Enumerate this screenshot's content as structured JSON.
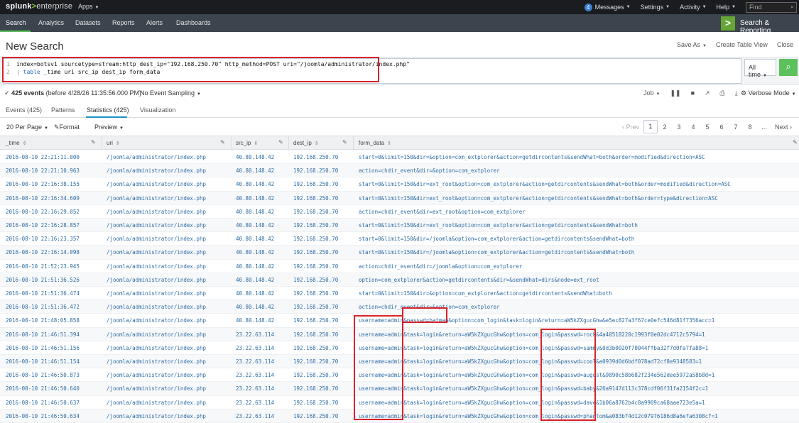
{
  "topbar": {
    "logo_main": "splunk",
    "logo_gt": ">",
    "logo_suffix": "enterprise",
    "apps": "Apps",
    "messages_count": "4",
    "messages": "Messages",
    "settings": "Settings",
    "activity": "Activity",
    "help": "Help",
    "find_placeholder": "Find"
  },
  "appbar": {
    "items": [
      "Search",
      "Analytics",
      "Datasets",
      "Reports",
      "Alerts",
      "Dashboards"
    ],
    "app_name": "Search & Reporting"
  },
  "title": {
    "text": "New Search",
    "save_as": "Save As",
    "create_table_view": "Create Table View",
    "close": "Close"
  },
  "search": {
    "line1": "index=botsv1 sourcetype=stream:http dest_ip=\"192.168.250.70\" http_method=POST uri=\"/joomla/administrator/index.php\"",
    "line2_pipe": "| ",
    "line2_cmd": "table",
    "line2_rest": " _time uri src_ip dest_ip form_data",
    "line_numbers": [
      "1",
      "2"
    ],
    "time_range": "All time",
    "icons": {
      "run": "search-icon"
    }
  },
  "status": {
    "check": "✓",
    "events_count": "425 events",
    "events_detail": "(before 4/28/26 11:35:56.000 PM)",
    "sampling": "No Event Sampling",
    "job": "Job",
    "mode": "Verbose Mode"
  },
  "tabs": [
    "Events (425)",
    "Patterns",
    "Statistics (425)",
    "Visualization"
  ],
  "toolbar": {
    "per_page": "20 Per Page",
    "format": "Format",
    "preview": "Preview"
  },
  "pager": {
    "prev": "‹ Prev",
    "pages": [
      "1",
      "2",
      "3",
      "4",
      "5",
      "6",
      "7",
      "8"
    ],
    "ellipsis": "...",
    "next": "Next ›"
  },
  "table": {
    "columns": [
      "_time",
      "uri",
      "src_ip",
      "dest_ip",
      "form_data"
    ],
    "rows": [
      [
        "2016-08-10 22:21:11.000",
        "/joomla/administrator/index.php",
        "40.80.148.42",
        "192.168.250.70",
        "start=0&limit=150&dir=&option=com_extplorer&action=getdircontents&sendWhat=both&order=modified&direction=ASC"
      ],
      [
        "2016-08-10 22:21:10.963",
        "/joomla/administrator/index.php",
        "40.80.148.42",
        "192.168.250.70",
        "action=chdir_event&dir=&option=com_extplorer"
      ],
      [
        "2016-08-10 22:16:38.155",
        "/joomla/administrator/index.php",
        "40.80.148.42",
        "192.168.250.70",
        "start=0&limit=150&dir=ext_root&option=com_extplorer&action=getdircontents&sendWhat=both&order=modified&direction=ASC"
      ],
      [
        "2016-08-10 22:16:34.609",
        "/joomla/administrator/index.php",
        "40.80.148.42",
        "192.168.250.70",
        "start=0&limit=150&dir=ext_root&option=com_extplorer&action=getdircontents&sendWhat=both&order=type&direction=ASC"
      ],
      [
        "2016-08-10 22:16:29.052",
        "/joomla/administrator/index.php",
        "40.80.148.42",
        "192.168.250.70",
        "action=chdir_event&dir=ext_root&option=com_extplorer"
      ],
      [
        "2016-08-10 22:16:28.857",
        "/joomla/administrator/index.php",
        "40.80.148.42",
        "192.168.250.70",
        "start=0&limit=150&dir=ext_root&option=com_extplorer&action=getdircontents&sendWhat=both"
      ],
      [
        "2016-08-10 22:16:23.357",
        "/joomla/administrator/index.php",
        "40.80.148.42",
        "192.168.250.70",
        "start=0&limit=150&dir=/joomla&option=com_extplorer&action=getdircontents&sendWhat=both"
      ],
      [
        "2016-08-10 22:16:14.098",
        "/joomla/administrator/index.php",
        "40.80.148.42",
        "192.168.250.70",
        "start=0&limit=150&dir=/joomla&option=com_extplorer&action=getdircontents&sendWhat=both"
      ],
      [
        "2016-08-10 21:52:23.945",
        "/joomla/administrator/index.php",
        "40.80.148.42",
        "192.168.250.70",
        "action=chdir_event&dir=/joomla&option=com_extplorer"
      ],
      [
        "2016-08-10 21:51:36.526",
        "/joomla/administrator/index.php",
        "40.80.148.42",
        "192.168.250.70",
        "option=com_extplorer&action=getdircontents&dir=&sendWhat=dirs&node=ext_root"
      ],
      [
        "2016-08-10 21:51:36.474",
        "/joomla/administrator/index.php",
        "40.80.148.42",
        "192.168.250.70",
        "start=0&limit=150&dir=&option=com_extplorer&action=getdircontents&sendWhat=both"
      ],
      [
        "2016-08-10 21:51:36.472",
        "/joomla/administrator/index.php",
        "40.80.148.42",
        "192.168.250.70",
        "action=chdir_event&dir=&option=com_extplorer"
      ],
      [
        "2016-08-10 21:48:05.858",
        "/joomla/administrator/index.php",
        "40.80.148.42",
        "192.168.250.70",
        "username=admin&passwd=batman&option=com_login&task=login&return=aW5kZXgucGhw&e5ec827a3f67ce0efc546d81f7356acc=1"
      ],
      [
        "2016-08-10 21:46:51.394",
        "/joomla/administrator/index.php",
        "23.22.63.114",
        "192.168.250.70",
        "username=admin&task=login&return=aW5kZXgucGhw&option=com_login&passwd=rock&4a40518220c1993f0e02dc4712c5794=1"
      ],
      [
        "2016-08-10 21:46:51.156",
        "/joomla/administrator/index.php",
        "23.22.63.114",
        "192.168.250.70",
        "username=admin&task=login&return=aW5kZXgucGhw&option=com_login&passwd=sammy&0d3b0020f70044ffba32f7d0fa7fa88=1"
      ],
      [
        "2016-08-10 21:46:51.154",
        "/joomla/administrator/index.php",
        "23.22.63.114",
        "192.168.250.70",
        "username=admin&task=login&return=aW5kZXgucGhw&option=com_login&passwd=cool&a0939d0d6bdf078ad72cf8e9348583=1"
      ],
      [
        "2016-08-10 21:46:50.873",
        "/joomla/administrator/index.php",
        "23.22.63.114",
        "192.168.250.70",
        "username=admin&task=login&return=aW5kZXgucGhw&option=com_login&passwd=august&9890c58b682f234e562dee5972a58b8d=1"
      ],
      [
        "2016-08-10 21:46:50.640",
        "/joomla/administrator/index.php",
        "23.22.63.114",
        "192.168.250.70",
        "username=admin&task=login&return=aW5kZXgucGhw&option=com_login&passwd=baby&26a9147d113c378cdf06f31fa2154f2c=1"
      ],
      [
        "2016-08-10 21:46:50.637",
        "/joomla/administrator/index.php",
        "23.22.63.114",
        "192.168.250.70",
        "username=admin&task=login&return=aW5kZXgucGhw&option=com_login&passwd=dave&1b06a8762b4c8a9909ca68aae723e5a=1"
      ],
      [
        "2016-08-10 21:46:50.634",
        "/joomla/administrator/index.php",
        "23.22.63.114",
        "192.168.250.70",
        "username=admin&task=login&return=aW5kZXgucGhw&option=com_login&passwd=phantom&a083bf4d12c07976186d8a6efa6308cf=1"
      ]
    ]
  },
  "colors": {
    "accent_green": "#5cc05c",
    "annotation_red": "#d9222a",
    "link_blue": "#2e6da4",
    "topbar": "#1a1c20",
    "appbar": "#3c444d"
  }
}
